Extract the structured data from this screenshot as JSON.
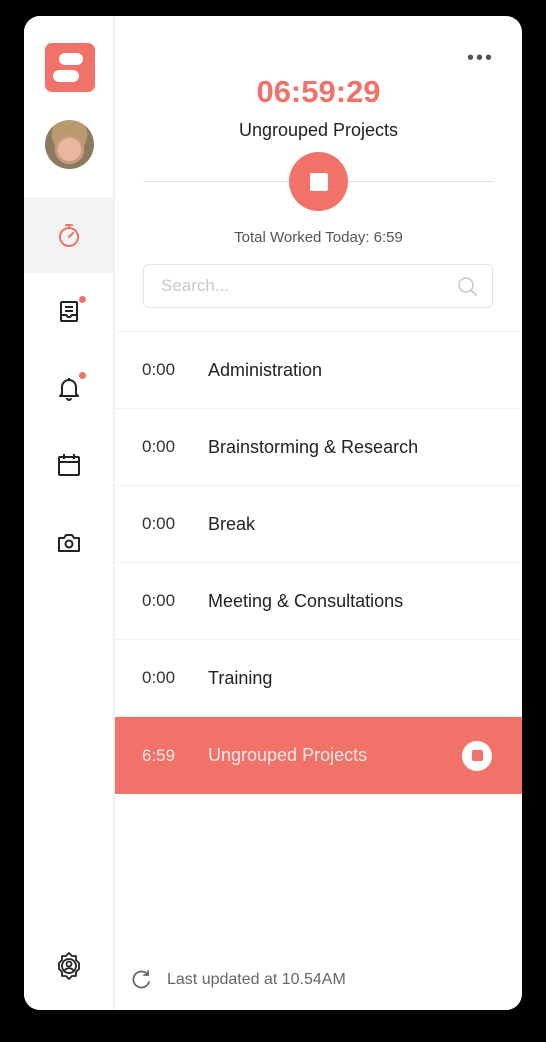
{
  "sidebar": {
    "logo": "app-logo",
    "avatar": "user-avatar",
    "items": [
      {
        "id": "timer",
        "icon": "stopwatch-icon",
        "active": true,
        "badge": false
      },
      {
        "id": "timesheet",
        "icon": "timesheet-icon",
        "active": false,
        "badge": true
      },
      {
        "id": "notifications",
        "icon": "bell-icon",
        "active": false,
        "badge": true
      },
      {
        "id": "calendar",
        "icon": "calendar-icon",
        "active": false,
        "badge": false
      },
      {
        "id": "screenshots",
        "icon": "camera-icon",
        "active": false,
        "badge": false
      }
    ],
    "settings_icon": "user-settings-icon"
  },
  "header": {
    "more_label": "•••",
    "timer": "06:59:29",
    "current_project": "Ungrouped Projects",
    "total_worked": "Total Worked Today: 6:59"
  },
  "search": {
    "placeholder": "Search...",
    "value": ""
  },
  "projects": [
    {
      "duration": "0:00",
      "name": "Administration",
      "active": false
    },
    {
      "duration": "0:00",
      "name": "Brainstorming & Research",
      "active": false
    },
    {
      "duration": "0:00",
      "name": "Break",
      "active": false
    },
    {
      "duration": "0:00",
      "name": "Meeting & Consultations",
      "active": false
    },
    {
      "duration": "0:00",
      "name": "Training",
      "active": false
    },
    {
      "duration": "6:59",
      "name": "Ungrouped Projects",
      "active": true
    }
  ],
  "footer": {
    "last_updated": "Last updated at 10.54AM"
  },
  "colors": {
    "accent": "#f07269",
    "active_nav_bg": "#f3f3f4"
  }
}
